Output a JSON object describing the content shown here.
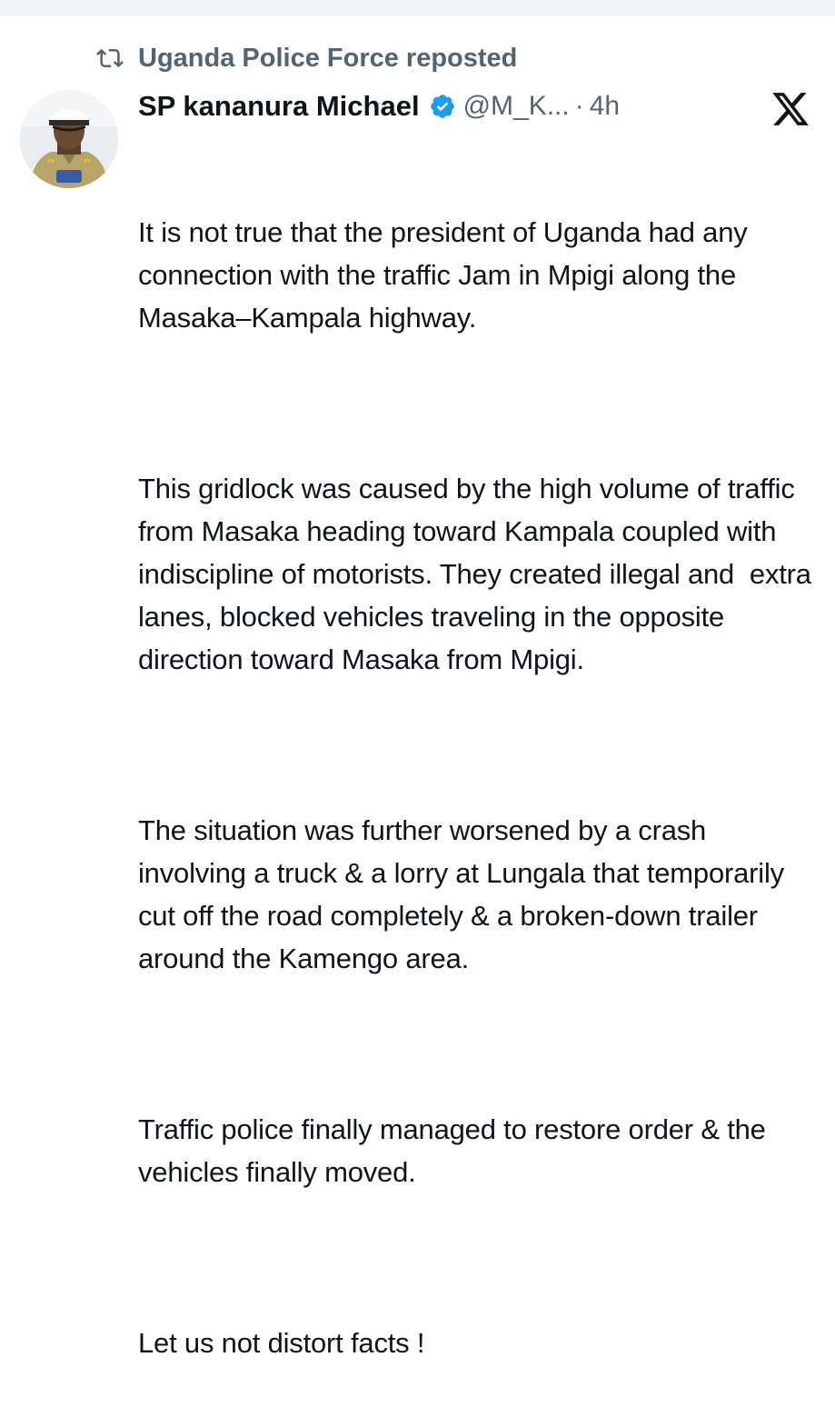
{
  "repost": {
    "label": "Uganda Police Force reposted",
    "icon": "repost-icon"
  },
  "tweet": {
    "author_name": "SP kananura Michael",
    "verified_icon": "verified-badge-icon",
    "handle": "@M_K...",
    "separator": "·",
    "time": "4h",
    "platform_icon": "x-logo-icon",
    "paragraphs": [
      "It is not true that the president of Uganda had any connection with the traffic Jam in Mpigi along the Masaka–Kampala highway.",
      "This gridlock was caused by the high volume of traffic from Masaka heading toward Kampala coupled with indiscipline of motorists. They created illegal and  extra lanes, blocked vehicles traveling in the opposite direction toward Masaka from Mpigi.",
      "The situation was further worsened by a crash  involving a truck & a lorry at Lungala that temporarily cut off the road completely & a broken-down trailer around the Kamengo area.",
      "Traffic police finally managed to restore order & the vehicles finally moved.",
      "Let us not distort facts !"
    ]
  },
  "colors": {
    "text_primary": "#0f1419",
    "text_secondary": "#536471",
    "verified_blue": "#1d9bf0"
  }
}
